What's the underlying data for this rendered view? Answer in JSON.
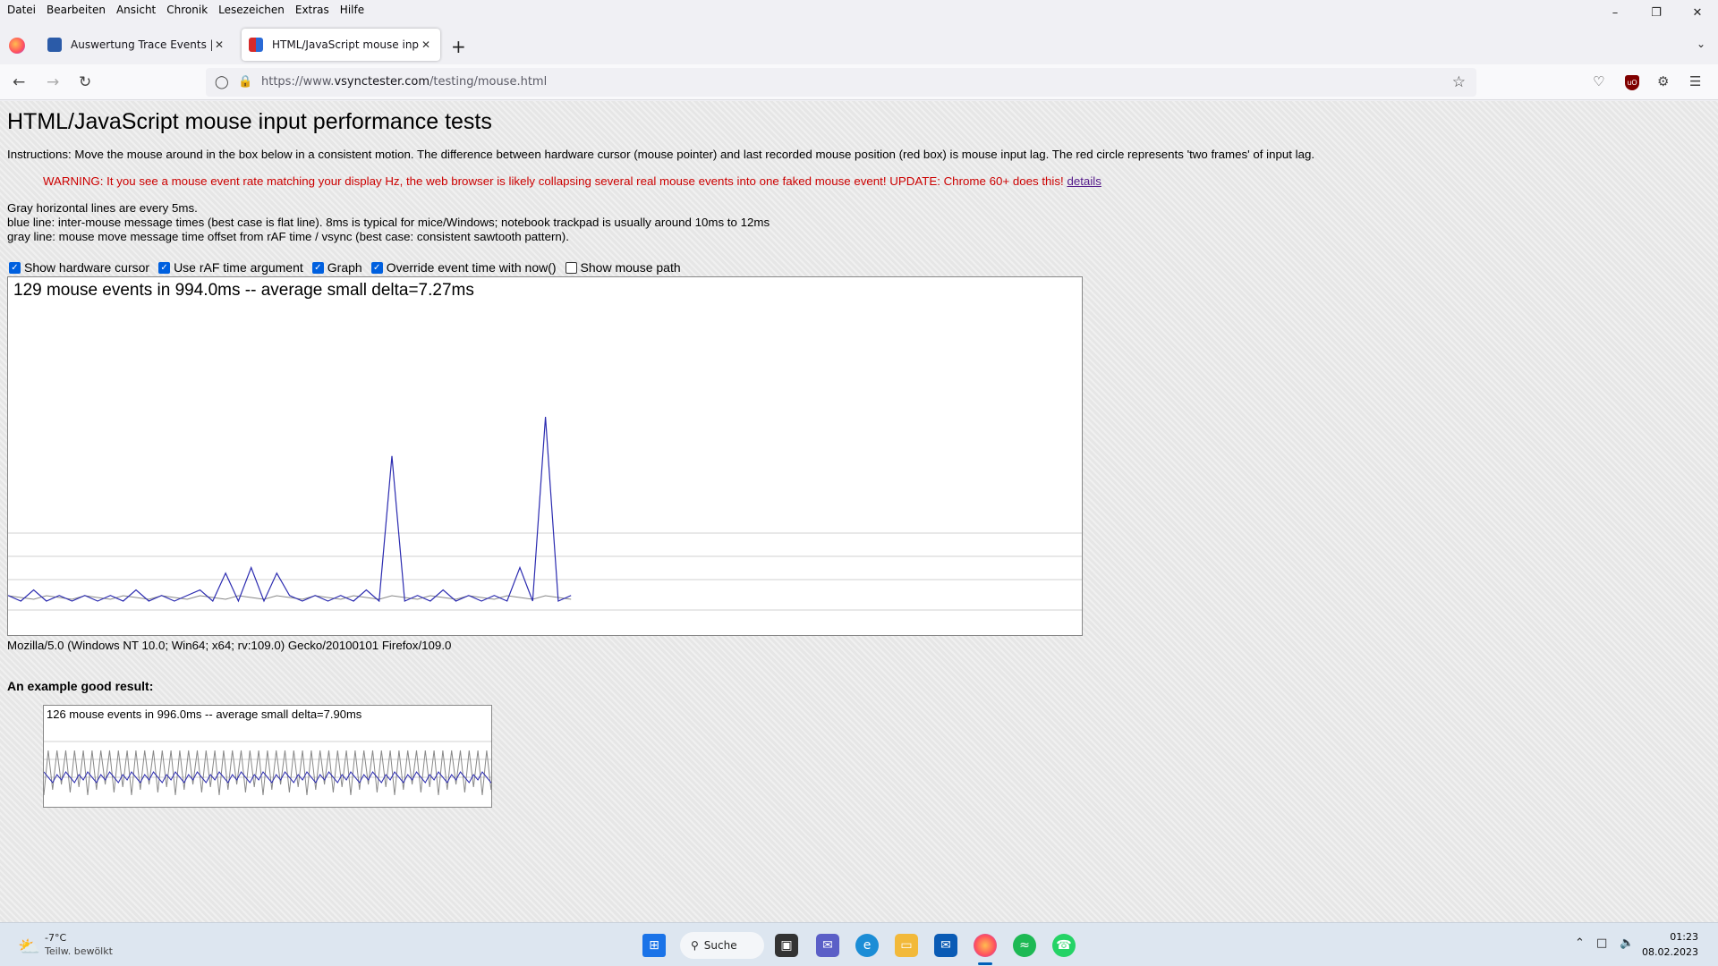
{
  "menubar": {
    "items": [
      "Datei",
      "Bearbeiten",
      "Ansicht",
      "Chronik",
      "Lesezeichen",
      "Extras",
      "Hilfe"
    ]
  },
  "window_controls": {
    "minimize": "–",
    "maximize": "❐",
    "close": "✕"
  },
  "tabs": [
    {
      "label": "Auswertung Trace Events | Com",
      "active": false
    },
    {
      "label": "HTML/JavaScript mouse input p",
      "active": true
    }
  ],
  "urlbar": {
    "url_prefix": "https://www.",
    "url_domain": "vsynctester.com",
    "url_path": "/testing/mouse.html"
  },
  "page": {
    "title": "HTML/JavaScript mouse input performance tests",
    "instructions": "Instructions: Move the mouse around in the box below in a consistent motion. The difference between hardware cursor (mouse pointer) and last recorded mouse position (red box) is mouse input lag. The red circle represents 'two frames' of input lag.",
    "warning": "WARNING: It you see a mouse event rate matching your display Hz, the web browser is likely collapsing several real mouse events into one faked mouse event! UPDATE: Chrome 60+ does this!",
    "warning_link": "details",
    "legend_lines": [
      "Gray horizontal lines are every 5ms.",
      "blue line: inter-mouse message times (best case is flat line). 8ms is typical for mice/Windows; notebook trackpad is usually around 10ms to 12ms",
      "gray line: mouse move message time offset from rAF time / vsync (best case: consistent sawtooth pattern)."
    ],
    "options": [
      {
        "label": "Show hardware cursor",
        "checked": true
      },
      {
        "label": "Use rAF time argument",
        "checked": true
      },
      {
        "label": "Graph",
        "checked": true
      },
      {
        "label": "Override event time with now()",
        "checked": true
      },
      {
        "label": "Show mouse path",
        "checked": false
      }
    ],
    "graph_caption": "129 mouse events in 994.0ms -- average small delta=7.27ms",
    "user_agent": "Mozilla/5.0 (Windows NT 10.0; Win64; x64; rv:109.0) Gecko/20100101 Firefox/109.0",
    "example_heading": "An example good result:",
    "example_caption": "126 mouse events in 996.0ms -- average small delta=7.90ms"
  },
  "chart_data": {
    "type": "line",
    "series": [
      {
        "values": [
          8,
          7,
          9,
          7,
          8,
          7,
          8,
          7,
          8,
          7,
          9,
          7,
          8,
          7,
          8,
          9,
          7,
          12,
          7,
          13,
          7,
          12,
          8,
          7,
          8,
          7,
          8,
          7,
          9,
          7,
          33,
          7,
          8,
          7,
          9,
          7,
          8,
          7,
          8,
          7,
          13,
          7,
          40,
          7,
          8
        ]
      }
    ],
    "colors": {
      "blue_line": "#2b2bb0",
      "gray_line": "#888888",
      "grid": "#d0d0d0"
    }
  },
  "taskbar": {
    "weather_temp": "-7°C",
    "weather_desc": "Teilw. bewölkt",
    "search_label": "Suche",
    "time": "01:23",
    "date": "08.02.2023"
  }
}
